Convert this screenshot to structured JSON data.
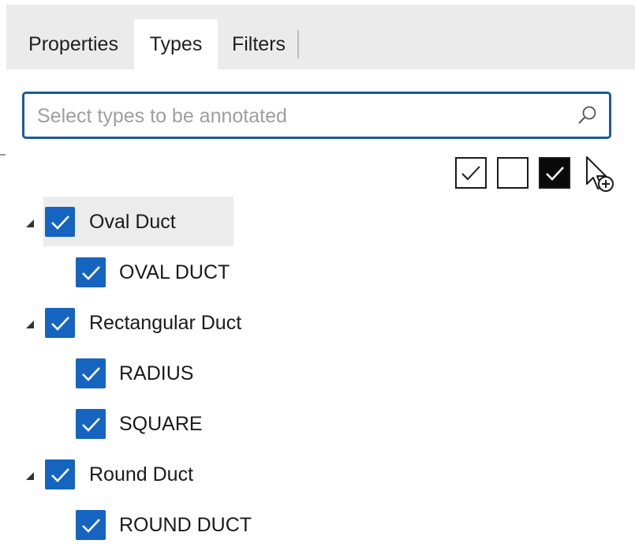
{
  "tabs": {
    "properties": "Properties",
    "types": "Types",
    "filters": "Filters"
  },
  "search": {
    "placeholder": "Select types to be annotated",
    "value": "",
    "icon": "search-icon"
  },
  "toolbar": {
    "buttons": [
      {
        "name": "check-all",
        "icon": "checkbox-checked-outline-icon"
      },
      {
        "name": "uncheck-all",
        "icon": "checkbox-empty-icon"
      },
      {
        "name": "check-filled",
        "icon": "checkbox-checked-filled-icon"
      },
      {
        "name": "select-in-model",
        "icon": "cursor-add-icon"
      }
    ]
  },
  "tree": {
    "groups": [
      {
        "label": "Oval Duct",
        "checked": true,
        "expanded": true,
        "selected": true,
        "children": [
          {
            "label": "OVAL DUCT",
            "checked": true
          }
        ]
      },
      {
        "label": "Rectangular Duct",
        "checked": true,
        "expanded": true,
        "selected": false,
        "children": [
          {
            "label": "RADIUS",
            "checked": true
          },
          {
            "label": "SQUARE",
            "checked": true
          }
        ]
      },
      {
        "label": "Round Duct",
        "checked": true,
        "expanded": true,
        "selected": false,
        "children": [
          {
            "label": "ROUND DUCT",
            "checked": true
          }
        ]
      }
    ]
  },
  "colors": {
    "accent": "#1565c0",
    "search_border": "#1b5a9c",
    "tabbar_bg": "#ebebeb",
    "selection_bg": "#ececec"
  }
}
